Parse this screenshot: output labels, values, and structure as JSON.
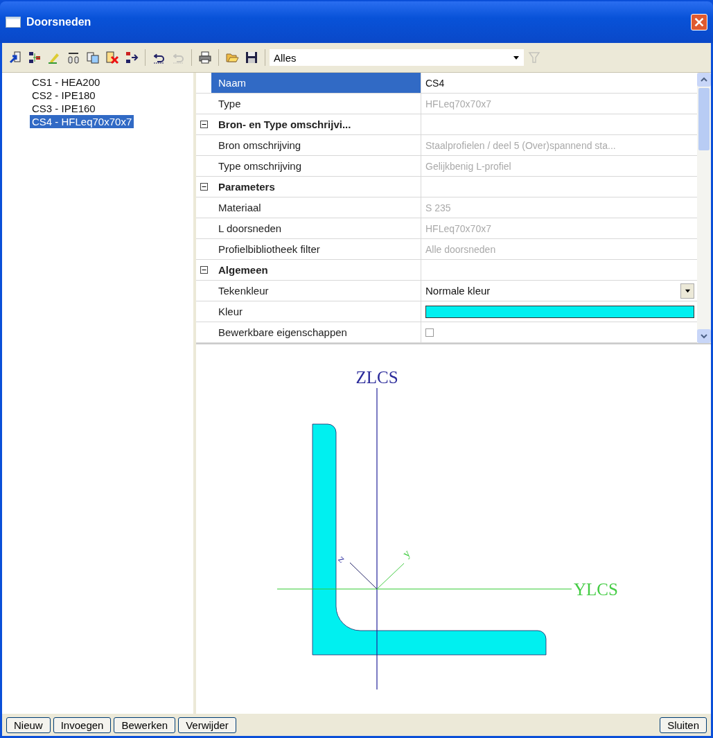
{
  "window": {
    "title": "Doorsneden"
  },
  "toolbar": {
    "buttons": [
      {
        "kind": "import",
        "disabled": false
      },
      {
        "kind": "split",
        "disabled": false
      },
      {
        "kind": "edit",
        "disabled": false
      },
      {
        "kind": "compare",
        "disabled": false
      },
      {
        "kind": "copy",
        "disabled": false
      },
      {
        "kind": "delete",
        "disabled": false
      },
      {
        "kind": "merge",
        "disabled": false
      },
      {
        "kind": "undo",
        "disabled": false
      },
      {
        "kind": "redo",
        "disabled": true
      },
      {
        "kind": "print",
        "disabled": false
      },
      {
        "kind": "open",
        "disabled": false
      },
      {
        "kind": "save",
        "disabled": false
      }
    ],
    "filter": {
      "value": "Alles"
    },
    "filter_button": {
      "disabled": true
    }
  },
  "sections": [
    {
      "label": "CS1 - HEA200",
      "selected": false
    },
    {
      "label": "CS2 - IPE180",
      "selected": false
    },
    {
      "label": "CS3 - IPE160",
      "selected": false
    },
    {
      "label": "CS4 - HFLeq70x70x7",
      "selected": true
    }
  ],
  "properties": [
    {
      "kind": "value",
      "label": "Naam",
      "value": "CS4",
      "selected": true,
      "disabled": false
    },
    {
      "kind": "value",
      "label": "Type",
      "value": "HFLeq70x70x7",
      "selected": false,
      "disabled": true
    },
    {
      "kind": "group",
      "label": "Bron- en Type omschrijvi...",
      "expanded": true
    },
    {
      "kind": "value",
      "label": "Bron omschrijving",
      "value": "Staalprofielen / deel 5 (Over)spannend sta...",
      "selected": false,
      "disabled": true
    },
    {
      "kind": "value",
      "label": "Type omschrijving",
      "value": "Gelijkbenig L-profiel",
      "selected": false,
      "disabled": true
    },
    {
      "kind": "group",
      "label": "Parameters",
      "expanded": true
    },
    {
      "kind": "value",
      "label": "Materiaal",
      "value": "S 235",
      "selected": false,
      "disabled": true
    },
    {
      "kind": "value",
      "label": "L doorsneden",
      "value": "HFLeq70x70x7",
      "selected": false,
      "disabled": true
    },
    {
      "kind": "value",
      "label": "Profielbibliotheek filter",
      "value": "Alle doorsneden",
      "selected": false,
      "disabled": true
    },
    {
      "kind": "group",
      "label": "Algemeen",
      "expanded": true
    },
    {
      "kind": "dropdown",
      "label": "Tekenkleur",
      "value": "Normale kleur",
      "selected": false,
      "disabled": false
    },
    {
      "kind": "color",
      "label": "Kleur",
      "color": "#00f0f0",
      "selected": false
    },
    {
      "kind": "checkbox",
      "label": "Bewerkbare eigenschappen",
      "checked": false,
      "selected": false
    }
  ],
  "drawing": {
    "z_axis_label": "ZLCS",
    "y_axis_label": "YLCS",
    "local_z_label": "z",
    "local_y_label": "y"
  },
  "buttons_left": [
    "Nieuw",
    "Invoegen",
    "Bewerken",
    "Verwijder"
  ],
  "buttons_right": [
    "Sluiten"
  ]
}
